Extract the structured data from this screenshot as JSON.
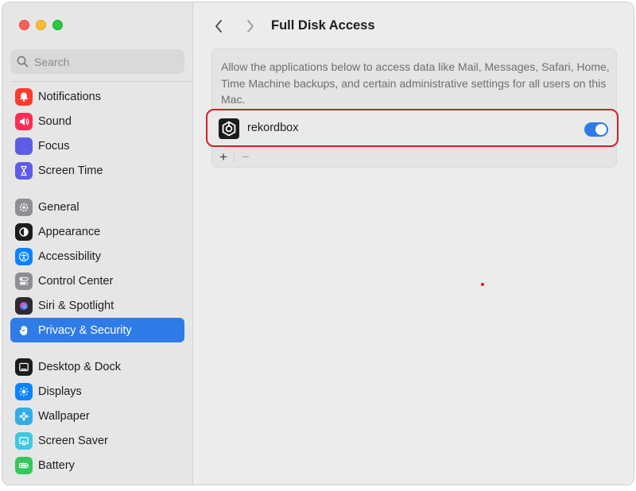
{
  "window": {
    "title": "Full Disk Access"
  },
  "search": {
    "placeholder": "Search",
    "value": ""
  },
  "sidebar": {
    "items": [
      {
        "label": "Notifications",
        "icon": "bell-icon",
        "color": "#ff3b30"
      },
      {
        "label": "Sound",
        "icon": "speaker-icon",
        "color": "#ff2d55"
      },
      {
        "label": "Focus",
        "icon": "moon-icon",
        "color": "#5e5ce6"
      },
      {
        "label": "Screen Time",
        "icon": "hourglass-icon",
        "color": "#5e5ce6"
      },
      {
        "label": "General",
        "icon": "gear-icon",
        "color": "#8e8e93"
      },
      {
        "label": "Appearance",
        "icon": "appearance-icon",
        "color": "#1c1c1e"
      },
      {
        "label": "Accessibility",
        "icon": "accessibility-icon",
        "color": "#0a84ff"
      },
      {
        "label": "Control Center",
        "icon": "switches-icon",
        "color": "#8e8e93"
      },
      {
        "label": "Siri & Spotlight",
        "icon": "siri-icon",
        "color": "#2c2c2e"
      },
      {
        "label": "Privacy & Security",
        "icon": "hand-icon",
        "color": "#2f7ce8",
        "selected": true
      },
      {
        "label": "Desktop & Dock",
        "icon": "dock-icon",
        "color": "#1c1c1e"
      },
      {
        "label": "Displays",
        "icon": "sun-icon",
        "color": "#0a84ff"
      },
      {
        "label": "Wallpaper",
        "icon": "flower-icon",
        "color": "#32ade6"
      },
      {
        "label": "Screen Saver",
        "icon": "screensaver-icon",
        "color": "#40c8e0"
      },
      {
        "label": "Battery",
        "icon": "battery-icon",
        "color": "#34c759"
      }
    ]
  },
  "main": {
    "description": "Allow the applications below to access data like Mail, Messages, Safari, Home, Time Machine backups, and certain administrative settings for all users on this Mac.",
    "apps": [
      {
        "name": "rekordbox",
        "icon": "rekordbox-icon",
        "enabled": true
      }
    ],
    "add_label": "+",
    "remove_label": "−"
  },
  "colors": {
    "accent": "#2f7ce8",
    "highlight_border": "#d42020"
  }
}
